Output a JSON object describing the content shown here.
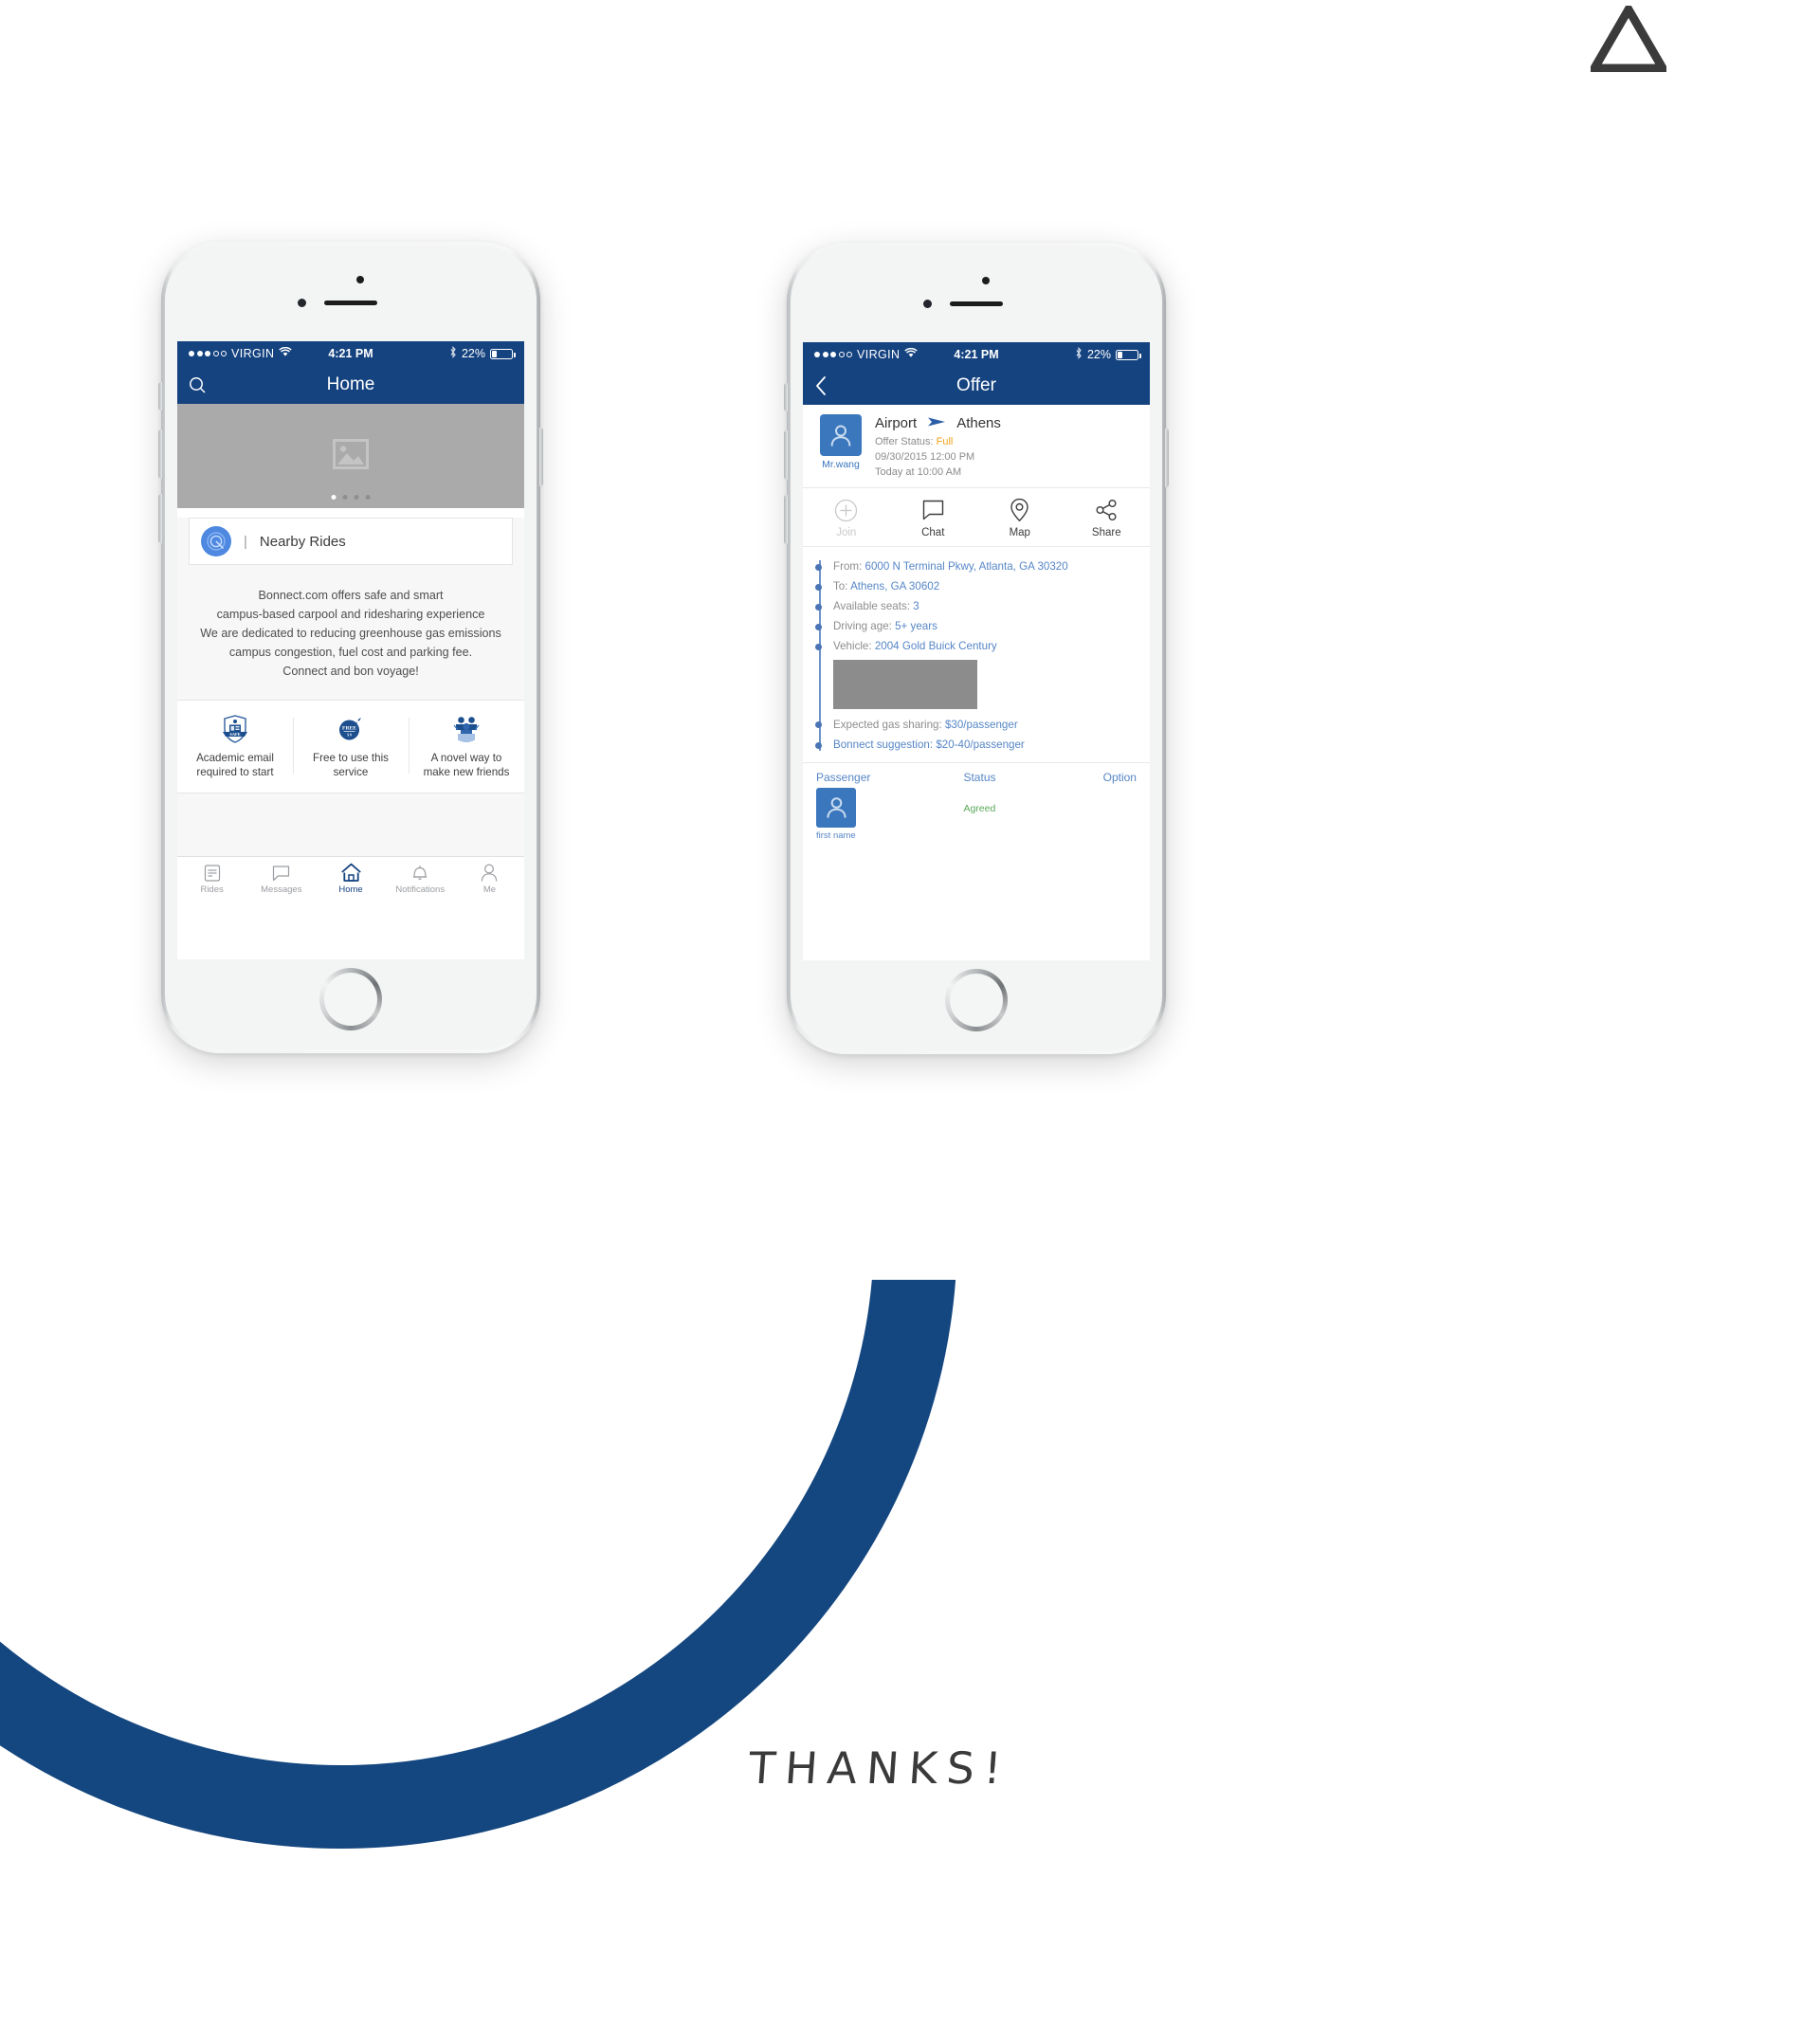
{
  "page": {
    "thanks_text": "THANKS!",
    "logo_icon": "triangle-outline-logo",
    "brand_blue": "#14467f",
    "nav_blue": "#154380"
  },
  "phone_home": {
    "status_bar": {
      "carrier": "VIRGIN",
      "signal_dots_filled": 3,
      "signal_dots_total": 5,
      "wifi_icon": "wifi-icon",
      "time": "4:21 PM",
      "bluetooth_icon": "bluetooth-icon",
      "battery_percent": "22%",
      "battery_icon": "battery-icon"
    },
    "nav": {
      "title": "Home",
      "left_icon": "search-icon"
    },
    "hero": {
      "placeholder_icon": "image-placeholder-icon",
      "page_dots": 4,
      "active_dot": 1
    },
    "nearby": {
      "logo_icon": "bonnect-target-logo-icon",
      "separator": "|",
      "label": "Nearby Rides"
    },
    "blurb_lines": [
      "Bonnect.com offers safe and smart",
      "campus-based carpool and ridesharing experience",
      "We are dedicated to reducing greenhouse gas emissions",
      "campus congestion, fuel cost and parking fee.",
      "Connect and bon voyage!"
    ],
    "features": [
      {
        "icon": "safe-shield-badge-icon",
        "line1": "Academic email",
        "line2": "required to start"
      },
      {
        "icon": "free-tag-icon",
        "line1": "Free to use this",
        "line2": "service"
      },
      {
        "icon": "friends-group-icon",
        "line1": "A novel way to",
        "line2": "make new friends"
      }
    ],
    "tabs": [
      {
        "icon": "rides-list-icon",
        "label": "Rides",
        "active": false
      },
      {
        "icon": "messages-bubble-icon",
        "label": "Messages",
        "active": false
      },
      {
        "icon": "home-icon",
        "label": "Home",
        "active": true
      },
      {
        "icon": "bell-icon",
        "label": "Notifications",
        "active": false
      },
      {
        "icon": "person-icon",
        "label": "Me",
        "active": false
      }
    ]
  },
  "phone_offer": {
    "status_bar": {
      "carrier": "VIRGIN",
      "signal_dots_filled": 3,
      "signal_dots_total": 5,
      "wifi_icon": "wifi-icon",
      "time": "4:21 PM",
      "bluetooth_icon": "bluetooth-icon",
      "battery_percent": "22%",
      "battery_icon": "battery-icon"
    },
    "nav": {
      "title": "Offer",
      "left_icon": "back-chevron-icon"
    },
    "header": {
      "avatar_icon": "person-avatar-icon",
      "driver_name": "Mr.wang",
      "origin": "Airport",
      "arrow_icon": "arrow-right-icon",
      "destination": "Athens",
      "status_label": "Offer Status:",
      "status_value": "Full",
      "depart_datetime": "09/30/2015 12:00 PM",
      "posted": "Today at 10:00 AM"
    },
    "actions": [
      {
        "icon": "plus-circle-icon",
        "label": "Join",
        "disabled": true
      },
      {
        "icon": "chat-bubble-icon",
        "label": "Chat",
        "disabled": false
      },
      {
        "icon": "map-pin-icon",
        "label": "Map",
        "disabled": false
      },
      {
        "icon": "share-nodes-icon",
        "label": "Share",
        "disabled": false
      }
    ],
    "details": [
      {
        "label": "From:",
        "value": "6000 N Terminal Pkwy, Atlanta, GA 30320"
      },
      {
        "label": "To:",
        "value": "Athens, GA 30602"
      },
      {
        "label": "Available seats:",
        "value": "3"
      },
      {
        "label": "Driving age:",
        "value": "5+ years"
      },
      {
        "label": "Vehicle:",
        "value": "2004 Gold Buick Century"
      }
    ],
    "vehicle_photo_placeholder": "vehicle-photo-placeholder",
    "details_after": [
      {
        "label": "Expected gas sharing:",
        "value": "$30/passenger"
      },
      {
        "label": "Bonnect suggestion:",
        "value": "$20-40/passenger"
      }
    ],
    "passenger_table": {
      "columns": [
        "Passenger",
        "Status",
        "Option"
      ],
      "rows": [
        {
          "avatar_icon": "person-avatar-icon",
          "name": "first name",
          "status": "Agreed",
          "option": ""
        }
      ]
    }
  }
}
